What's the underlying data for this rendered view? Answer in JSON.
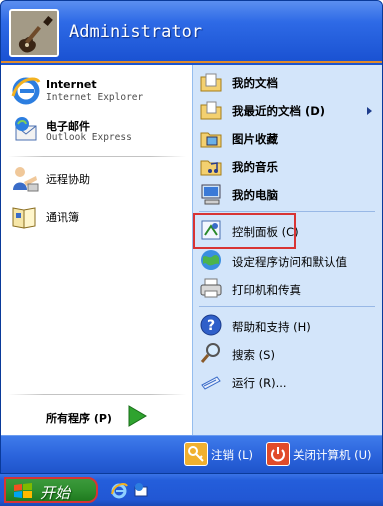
{
  "user": {
    "name": "Administrator"
  },
  "pinned": [
    {
      "name": "Internet",
      "subtitle": "Internet Explorer",
      "icon": "internet-explorer-icon"
    },
    {
      "name": "电子邮件",
      "subtitle": "Outlook Express",
      "icon": "outlook-express-icon"
    }
  ],
  "recent": [
    {
      "label": "远程协助",
      "icon": "remote-assistance-icon"
    },
    {
      "label": "通讯簿",
      "icon": "address-book-icon"
    }
  ],
  "all_programs": {
    "label": "所有程序 (P)",
    "icon": "green-arrow-icon"
  },
  "places": [
    {
      "label": "我的文档",
      "icon": "my-documents-icon"
    },
    {
      "label": "我最近的文档 (D)",
      "icon": "recent-documents-icon",
      "has_submenu": true
    },
    {
      "label": "图片收藏",
      "icon": "my-pictures-icon"
    },
    {
      "label": "我的音乐",
      "icon": "my-music-icon"
    },
    {
      "label": "我的电脑",
      "icon": "my-computer-icon"
    }
  ],
  "system": [
    {
      "label": "控制面板 (C)",
      "icon": "control-panel-icon",
      "highlighted": true
    },
    {
      "label": "设定程序访问和默认值",
      "icon": "program-defaults-icon"
    },
    {
      "label": "打印机和传真",
      "icon": "printers-icon"
    }
  ],
  "tools": [
    {
      "label": "帮助和支持 (H)",
      "icon": "help-icon"
    },
    {
      "label": "搜索 (S)",
      "icon": "search-icon"
    },
    {
      "label": "运行 (R)...",
      "icon": "run-icon"
    }
  ],
  "footer": {
    "logoff": {
      "label": "注销 (L)",
      "icon": "key-icon"
    },
    "shutdown": {
      "label": "关闭计算机 (U)",
      "icon": "power-icon"
    }
  },
  "taskbar": {
    "start_label": "开始",
    "quick_launch": [
      "internet-explorer-icon",
      "outlook-express-icon"
    ]
  },
  "colors": {
    "header_blue": "#2e6ae6",
    "right_pane": "#d3e5fa",
    "highlight_red": "#d83434",
    "start_green": "#2f8f2f",
    "accent_orange": "#e08b2b"
  }
}
